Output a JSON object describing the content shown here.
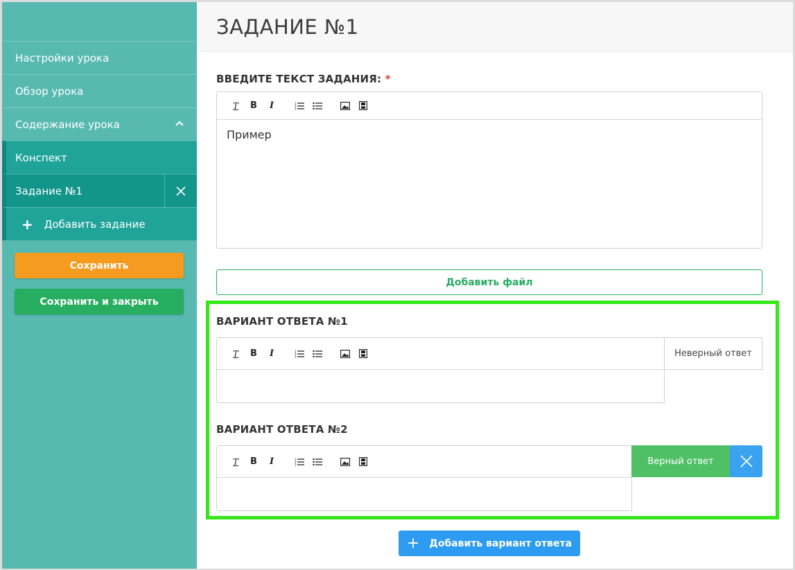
{
  "sidebar": {
    "items": [
      {
        "label": "Настройки урока"
      },
      {
        "label": "Обзор урока"
      },
      {
        "label": "Содержание урока"
      }
    ],
    "sub_items": [
      {
        "label": "Конспект"
      },
      {
        "label": "Задание №1"
      }
    ],
    "add_task_label": "Добавить задание",
    "save_label": "Сохранить",
    "save_close_label": "Сохранить и закрыть"
  },
  "main": {
    "title": "ЗАДАНИЕ №1",
    "task_label": "ВВЕДИТЕ ТЕКСТ ЗАДАНИЯ:",
    "required_mark": "*",
    "task_text": "Пример",
    "add_file_label": "Добавить файл",
    "answers": [
      {
        "label": "ВАРИАНТ ОТВЕТА №1",
        "text": "",
        "status": "Неверный ответ"
      },
      {
        "label": "ВАРИАНТ ОТВЕТА №2",
        "text": "",
        "status": "Верный ответ"
      }
    ],
    "add_answer_label": "Добавить вариант ответа"
  },
  "toolbar_icons": [
    "clear-format-icon",
    "bold-icon",
    "italic-icon",
    "numbered-list-icon",
    "bullet-list-icon",
    "image-icon",
    "video-icon"
  ],
  "colors": {
    "sidebar": "#57b9b0",
    "sidebar_sub": "#20a49a",
    "save": "#f59b1f",
    "save_close": "#27ae60",
    "highlight": "#35e81a",
    "correct": "#4fc065",
    "primary": "#2d9cf0"
  }
}
